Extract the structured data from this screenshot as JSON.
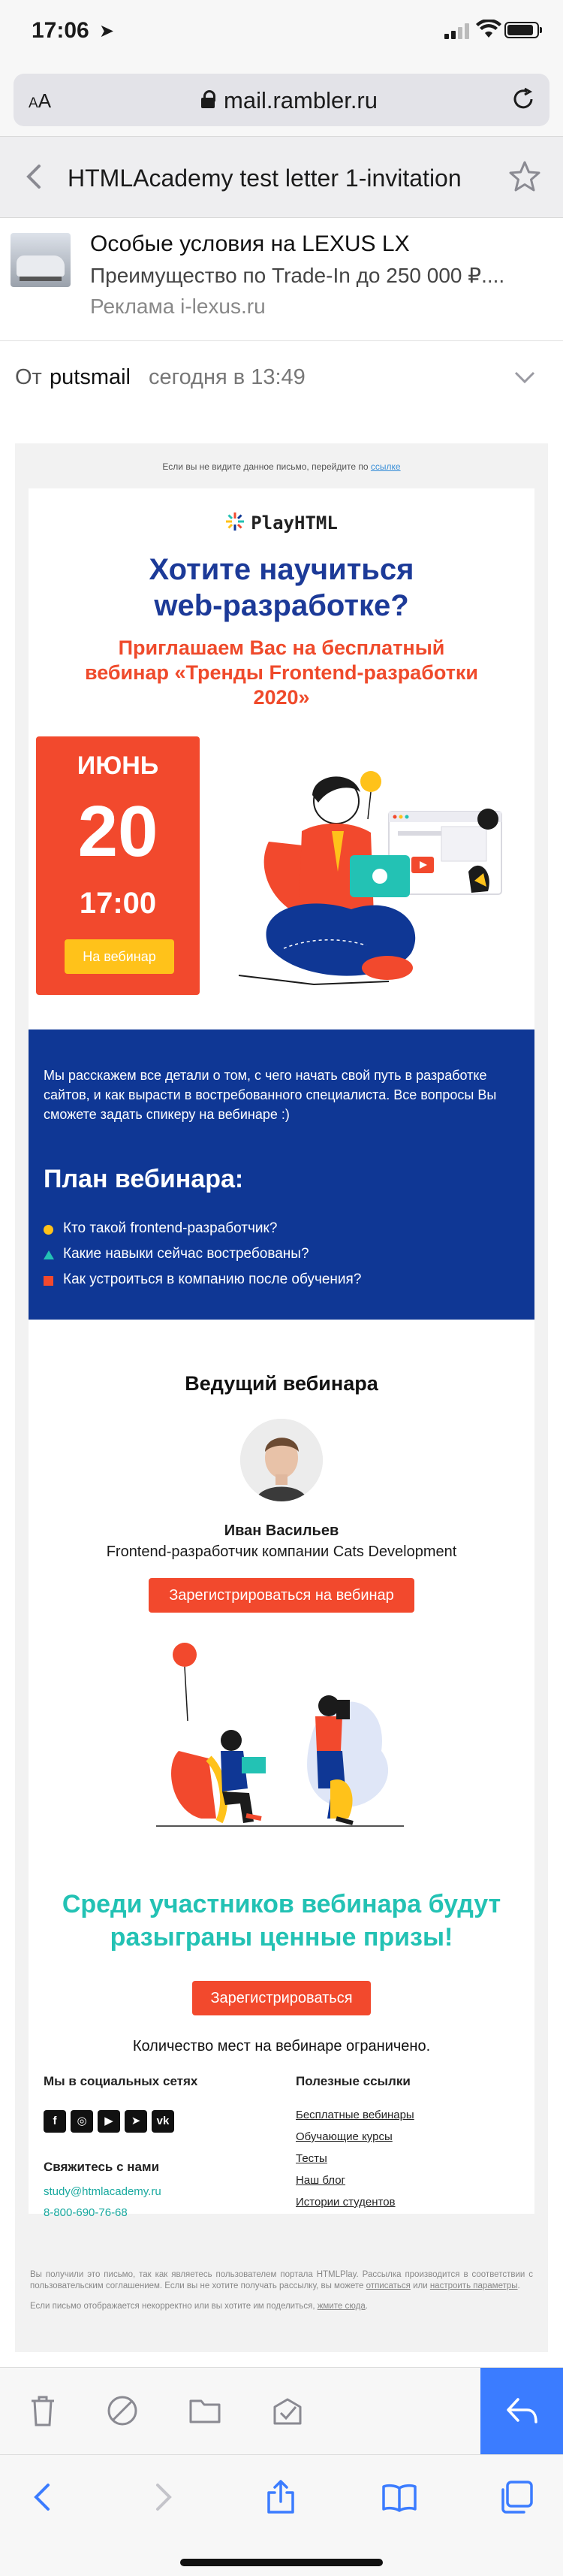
{
  "status_bar": {
    "time": "17:06"
  },
  "browser": {
    "text_size_label": "AA",
    "url": "mail.rambler.ru"
  },
  "mail_header": {
    "subject": "HTMLAcademy test letter 1-invitation"
  },
  "ad": {
    "title": "Особые условия на LEXUS LX",
    "text": "Преимущество по Trade-In до 250 000 ₽....",
    "source": "Реклама i-lexus.ru"
  },
  "message": {
    "from_label": "От",
    "sender": "putsmail",
    "date": "сегодня в 13:49"
  },
  "letter": {
    "view_notice": "Если вы не видите данное письмо, перейдите по",
    "view_link": "ссылке",
    "logo_text": "PlayHTML",
    "headline_line1": "Хотите научиться",
    "headline_line2": "web-разработке?",
    "invite_line1": "Приглашаем Вас на бесплатный",
    "invite_line2": "вебинар «Тренды Frontend-разработки",
    "invite_line3": "2020»",
    "event": {
      "month": "ИЮНЬ",
      "day": "20",
      "time": "17:00",
      "button": "На вебинар"
    },
    "intro": "Мы расскажем все детали о том, с чего начать свой путь в разработке сайтов, и как вырасти в востребованного специалиста. Все вопросы Вы сможете задать спикеру на вебинаре :)",
    "plan_title": "План вебинара:",
    "plan_items": [
      {
        "text": "Кто такой frontend-разработчик?",
        "color": "#ffc21a"
      },
      {
        "text": "Какие навыки сейчас востребованы?",
        "color": "#23c2b4"
      },
      {
        "text": "Как устроиться в компанию после обучения?",
        "color": "#f2492d"
      }
    ],
    "speaker_heading": "Ведущий вебинара",
    "speaker_name": "Иван Васильев",
    "speaker_role": "Frontend-разработчик компании Cats Development",
    "register_button": "Зарегистрироваться на вебинар",
    "prize_line1": "Среди участников вебинара будут",
    "prize_line2": "разыграны ценные призы!",
    "register_short": "Зарегистрироваться",
    "limited": "Количество мест на вебинаре ограничено.",
    "social_heading": "Мы в социальных сетях",
    "social_icons": [
      "facebook-icon",
      "instagram-icon",
      "youtube-icon",
      "telegram-icon",
      "vk-icon"
    ],
    "contact_heading": "Свяжитесь с нами",
    "contact_email": "study@htmlacademy.ru",
    "contact_phone": "8-800-690-76-68",
    "links_heading": "Полезные ссылки",
    "links": [
      "Бесплатные вебинары",
      "Обучающие курсы",
      "Тесты",
      "Наш блог",
      "Истории студентов"
    ],
    "legal_1": "Вы получили это письмо, так как являетесь пользователем портала HTMLPlay. Рассылка производится в соответствии с пользовательским соглашением. Если вы не хотите получать рассылку, вы можете",
    "legal_unsubscribe": "отписаться",
    "legal_or": "или",
    "legal_settings": "настроить параметры",
    "legal_2": "Если письмо отображается некорректно или вы хотите им поделиться,",
    "legal_link": "жмите сюда"
  },
  "colors": {
    "navy": "#0f3795",
    "orange_red": "#f2492d",
    "teal": "#23c2b4",
    "yellow": "#ffc21a",
    "reply_blue": "#3b7cff"
  }
}
